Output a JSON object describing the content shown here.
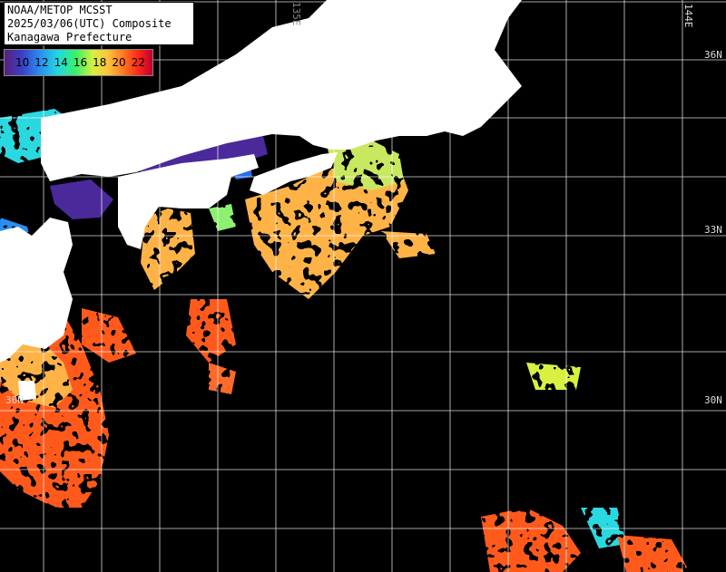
{
  "title": {
    "line1": "NOAA/METOP MCSST",
    "line2": "2025/03/06(UTC) Composite",
    "line3": "Kanagawa Prefecture"
  },
  "legend": {
    "ticks": [
      "10",
      "12",
      "14",
      "16",
      "18",
      "20",
      "22"
    ]
  },
  "grid_labels": {
    "lat": [
      "36N",
      "33N",
      "30N",
      "30N"
    ],
    "lon": [
      "135E",
      "144E"
    ]
  },
  "colors": {
    "land": "#ffffff",
    "sea_nodata": "#000000",
    "grid": "#ffffff",
    "cold": "#4a2a9a",
    "cool": "#2a8ef0",
    "mid": "#d8f040",
    "warm": "#ffb347",
    "hot": "#ff5a1a"
  }
}
